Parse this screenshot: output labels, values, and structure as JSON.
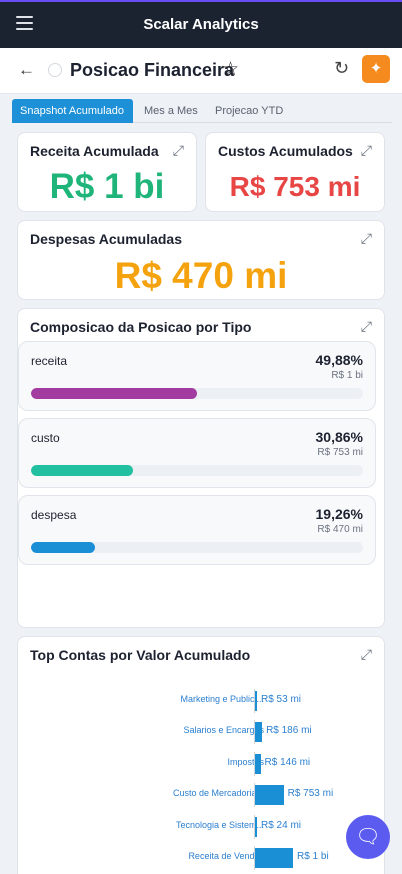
{
  "app": {
    "title": "Scalar Analytics"
  },
  "page": {
    "title": "Posicao Financeira"
  },
  "tabs": [
    {
      "label": "Snapshot Acumulado",
      "active": true
    },
    {
      "label": "Mes a Mes",
      "active": false
    },
    {
      "label": "Projecao YTD",
      "active": false
    }
  ],
  "kpis": {
    "receita": {
      "title": "Receita Acumulada",
      "value": "R$ 1 bi",
      "color": "#1fb57a"
    },
    "custos": {
      "title": "Custos Acumulados",
      "value": "R$ 753 mi",
      "color": "#e84545"
    },
    "despesas": {
      "title": "Despesas Acumuladas",
      "value": "R$ 470 mi",
      "color": "#f5a20f"
    }
  },
  "composition": {
    "title": "Composicao da Posicao por Tipo",
    "items": [
      {
        "name": "receita",
        "percent_label": "49,88%",
        "amount": "R$ 1 bi",
        "share": 0.4988,
        "color": "#a23ca0"
      },
      {
        "name": "custo",
        "percent_label": "30,86%",
        "amount": "R$ 753 mi",
        "share": 0.3086,
        "color": "#20c0a0"
      },
      {
        "name": "despesa",
        "percent_label": "19,26%",
        "amount": "R$ 470 mi",
        "share": 0.1926,
        "color": "#1a8fd6"
      }
    ]
  },
  "top_contas": {
    "title": "Top Contas por Valor Acumulado",
    "bar_color": "#1a8fd6"
  },
  "chart_data": {
    "type": "bar",
    "orientation": "horizontal",
    "title": "Top Contas por Valor Acumulado",
    "categories": [
      "Marketing e Publici...",
      "Salarios e Encargos",
      "Impostos",
      "Custo de Mercadoria...",
      "Tecnologia e Sistem...",
      "Receita de Vendas"
    ],
    "values": [
      53,
      186,
      146,
      753,
      24,
      1000
    ],
    "value_labels": [
      "R$ 53 mi",
      "R$ 186 mi",
      "R$ 146 mi",
      "R$ 753 mi",
      "R$ 24 mi",
      "R$ 1 bi"
    ],
    "unit": "R$ mi"
  }
}
